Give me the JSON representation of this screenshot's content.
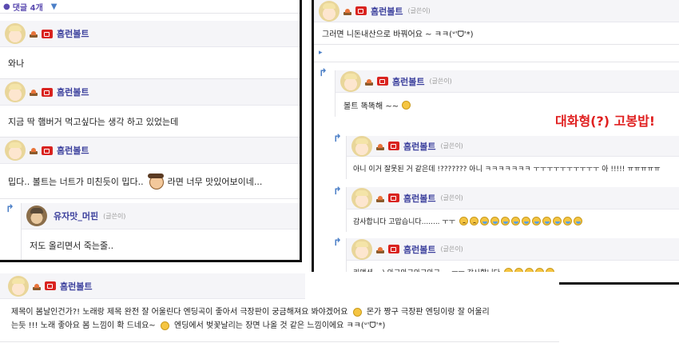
{
  "comments_header": {
    "label": "댓글 4개",
    "toggle_icon": "triangle-down-icon",
    "accent": "#5b4bb0"
  },
  "left_panel": {
    "comments": [
      {
        "nick": "흠런볼트",
        "body": "와나"
      },
      {
        "nick": "흠런볼트",
        "body": "지금 딱 햄버거 먹고싶다는 생각 하고 있었는데"
      },
      {
        "nick": "흠런볼트",
        "body_before": "밉다.. 볼트는 너트가 미친듯이 밉다..",
        "body_after": "라면 너무 맛있어보이네..."
      }
    ],
    "reply": {
      "nick": "유자맛_머핀",
      "tag": "(글쓴이)",
      "body": "저도 올리면서 죽는줄.."
    }
  },
  "right_panel": {
    "top": {
      "nick": "흠런볼트",
      "tag": "(글쓴이)",
      "body": "그러면 니돈내산으로 바꿔어요 ~ ㅋㅋ(ᐡ'ᗜ'*)"
    },
    "reply1": {
      "nick": "흠런볼트",
      "tag": "(글쓴이)",
      "body": "볼트 똑똑해 ~~"
    },
    "overlay": "대화형(?) 고봉밥!",
    "reply2": {
      "nick": "흠런볼트",
      "tag": "(글쓴이)",
      "body": "아니 이거 잘못된 거 같은데 !??????? 아니 ㅋㅋㅋㅋㅋㅋㅋ ㅜㅜㅜㅜㅜㅜㅜㅜㅜㅜ 아 !!!!! ㅠㅠㅠㅠㅠ"
    },
    "reply3": {
      "nick": "흠런볼트",
      "tag": "(글쓴이)",
      "body": "감사합니다 고맙습니다........ ㅜㅜ"
    },
    "reply4": {
      "nick": "흠런볼트",
      "tag": "(글쓴이)",
      "body": "리액션....) 와구와구와구와구.... ㅜㅜ 감사합니다"
    }
  },
  "bottom_panel": {
    "nick": "흠런볼트",
    "line1": "제목이 봄날인건가?! 노래랑 제목 완전 잘 어울린다 엔딩곡이 좋아서 극장판이 궁금해져요 봐야겠어요",
    "line1_after": "몬가 짱구 극장판 엔딩이랑 잘 어울리",
    "line2_before": "는듯 !!! 노래 좋아요 봄 느낌이 확 드네요~",
    "line2_after": "엔딩에서 벚꽃날리는 장면 나올 것 같은 느낌이에요 ㅋㅋ(ᐡ'ᗜ'*)"
  },
  "colors": {
    "nickname": "#3b3f9c",
    "reply_arrow": "#4b7fc7",
    "overlay_text": "#e02020",
    "live_badge": "#d9231f"
  }
}
